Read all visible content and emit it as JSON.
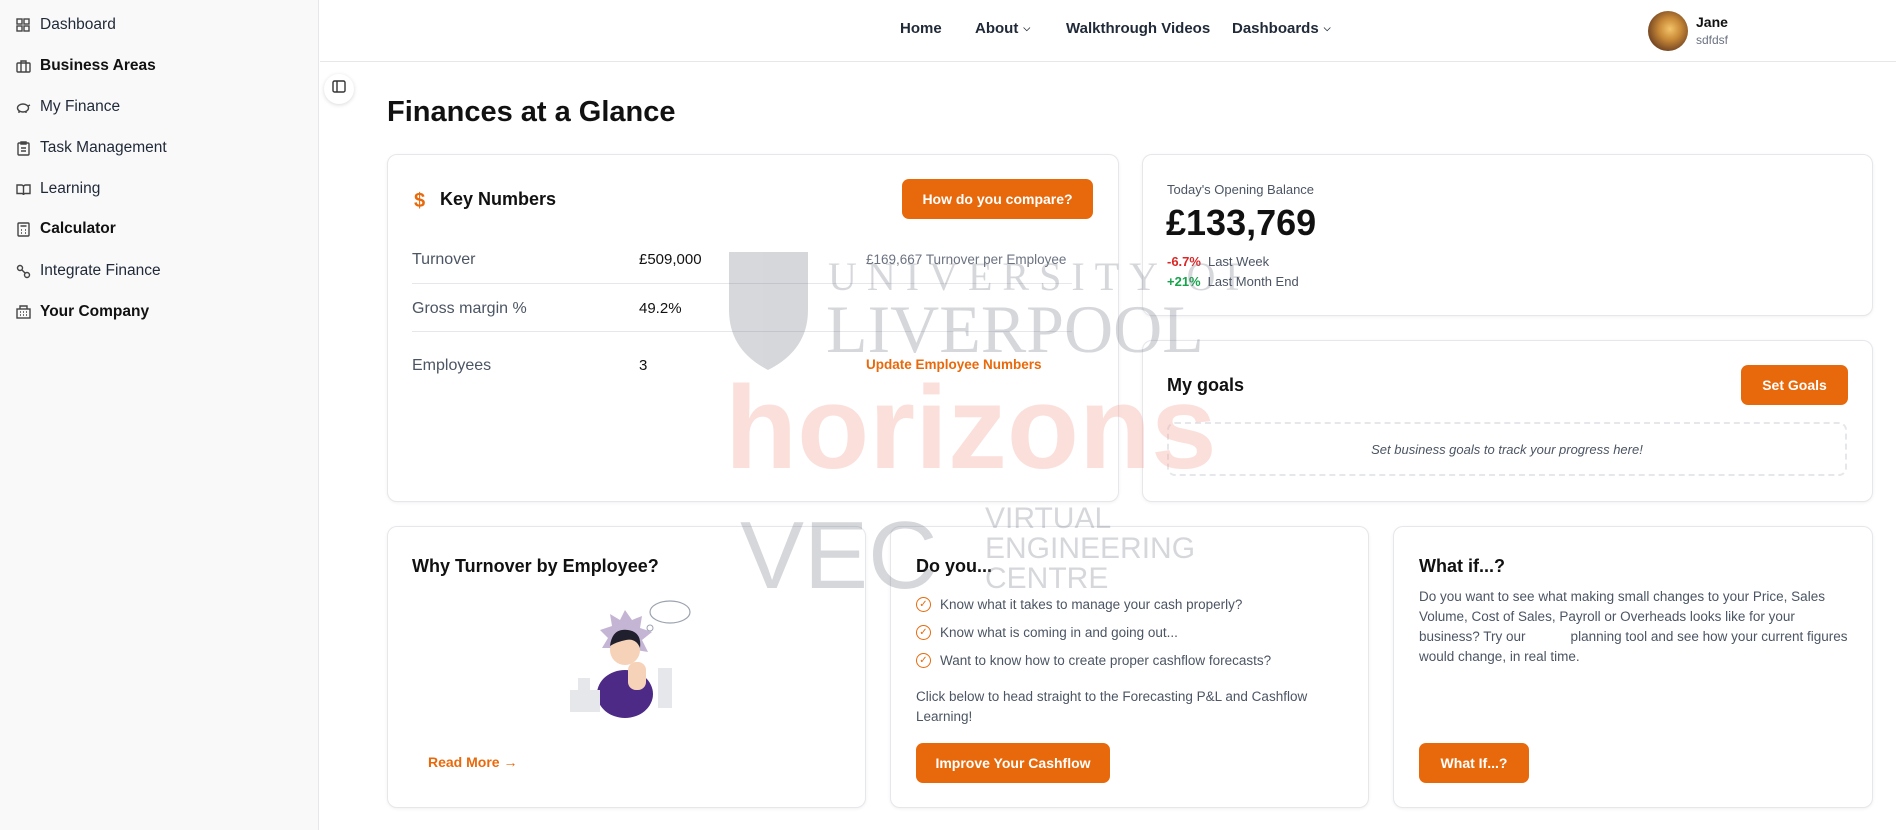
{
  "sidebar": {
    "items": [
      {
        "label": "Dashboard",
        "icon": "grid-icon"
      },
      {
        "label": "Business Areas",
        "icon": "briefcase-icon"
      },
      {
        "label": "My Finance",
        "icon": "piggy-bank-icon"
      },
      {
        "label": "Task Management",
        "icon": "clipboard-icon"
      },
      {
        "label": "Learning",
        "icon": "book-icon"
      },
      {
        "label": "Calculator",
        "icon": "calculator-icon"
      },
      {
        "label": "Integrate Finance",
        "icon": "link-icon"
      },
      {
        "label": "Your Company",
        "icon": "building-icon"
      }
    ]
  },
  "nav": {
    "home": "Home",
    "about": "About",
    "videos": "Walkthrough Videos",
    "dashboards": "Dashboards"
  },
  "user": {
    "name": "Jane",
    "sub": "sdfdsf"
  },
  "page": {
    "title": "Finances at a Glance"
  },
  "key_numbers": {
    "title": "Key Numbers",
    "compare_button": "How do you compare?",
    "rows": [
      {
        "label": "Turnover",
        "value": "£509,000",
        "note": "£169,667 Turnover per Employee"
      },
      {
        "label": "Gross margin %",
        "value": "49.2%"
      },
      {
        "label": "Employees",
        "value": "3",
        "action": "Update Employee Numbers"
      }
    ]
  },
  "opening_balance": {
    "label": "Today's Opening Balance",
    "value": "£133,769",
    "deltas": [
      {
        "change": "-6.7%",
        "period": "Last Week"
      },
      {
        "change": "+21%",
        "period": "Last Month End"
      }
    ]
  },
  "goals": {
    "title": "My goals",
    "button": "Set Goals",
    "empty": "Set business goals to track your progress here!"
  },
  "turnover_card": {
    "title": "Why Turnover by Employee?",
    "link": "Read More"
  },
  "do_you_card": {
    "title": "Do you...",
    "items": [
      "Know what it takes to manage your cash properly?",
      "Know what is coming in and going out...",
      "Want to know how to create proper cashflow forecasts?"
    ],
    "text": "Click below to head straight to the Forecasting P&L and Cashflow Learning!",
    "button": "Improve Your Cashflow"
  },
  "what_if_card": {
    "title": "What if...?",
    "text": "Do you want to see what making small changes to your Price, Sales Volume, Cost of Sales, Payroll or Overheads looks like for your business? Try our            planning tool and see how your current figures would change, in real time.",
    "button": "What If...?"
  },
  "watermark": {
    "line1": "UNIVERSITY OF",
    "line2": "LIVERPOOL",
    "line3": "horizons",
    "line4": "VEC",
    "line5": "VIRTUAL",
    "line6": "ENGINEERING",
    "line7": "CENTRE"
  },
  "colors": {
    "accent": "#e8690b",
    "negative": "#dc2626",
    "positive": "#16a34a"
  }
}
